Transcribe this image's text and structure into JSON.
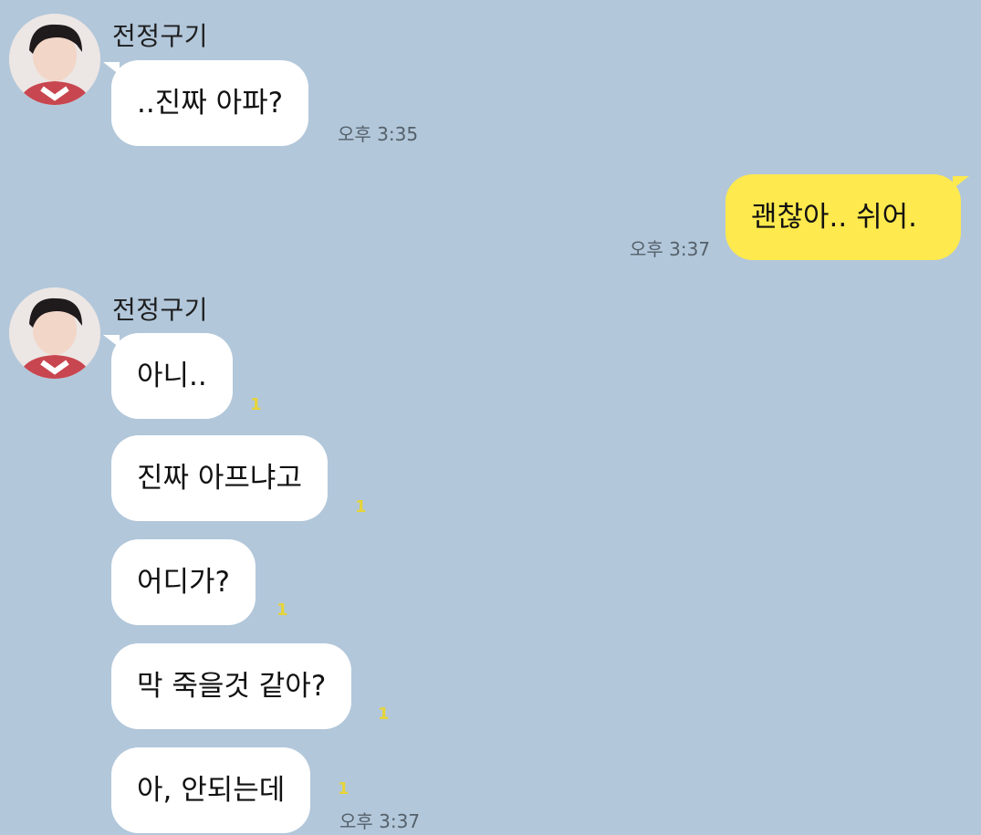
{
  "chat": {
    "groups": [
      {
        "sender": "전정구기",
        "messages": [
          {
            "text": "..진짜 아파?",
            "time": "오후 3:35"
          }
        ]
      },
      {
        "sender": "me",
        "messages": [
          {
            "text": "괜찮아.. 쉬어.",
            "time": "오후 3:37"
          }
        ]
      },
      {
        "sender": "전정구기",
        "messages": [
          {
            "text": "아니..",
            "unread": "1"
          },
          {
            "text": "진짜 아프냐고",
            "unread": "1"
          },
          {
            "text": "어디가?",
            "unread": "1"
          },
          {
            "text": "막 죽을것 같아?",
            "unread": "1"
          },
          {
            "text": "아, 안되는데",
            "unread": "1",
            "time": "오후 3:37"
          }
        ]
      }
    ]
  },
  "colors": {
    "background": "#b2c7da",
    "my_bubble": "#fee94e",
    "their_bubble": "#ffffff",
    "unread": "#e6d43a"
  }
}
